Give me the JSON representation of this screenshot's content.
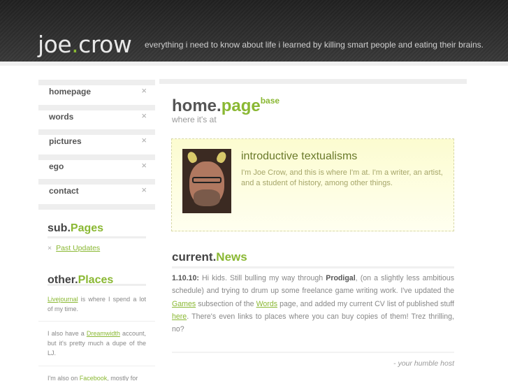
{
  "header": {
    "logo_part1": "joe",
    "logo_dot": ".",
    "logo_part2": "crow",
    "tagline": "everything i need to know about life i learned by killing smart people and eating their brains."
  },
  "nav": {
    "items": [
      {
        "label": "homepage"
      },
      {
        "label": "words"
      },
      {
        "label": "pictures"
      },
      {
        "label": "ego"
      },
      {
        "label": "contact"
      }
    ],
    "close_glyph": "×"
  },
  "sidebar": {
    "sub_pages": {
      "prefix": "sub.",
      "highlight": "Pages",
      "items": [
        {
          "label": "Past Updates"
        }
      ]
    },
    "other_places": {
      "prefix": "other.",
      "highlight": "Places",
      "p1_link": "Livejournal",
      "p1_text": " is where I spend a lot of my time.",
      "p2_text1": "I also have a ",
      "p2_link": "Dreamwidth",
      "p2_text2": " account, but it's pretty much a dupe of the LJ.",
      "p3_text1": "I'm also on ",
      "p3_link": "Facebook",
      "p3_text2": ", mostly for"
    }
  },
  "main": {
    "title_prefix": "home.",
    "title_highlight": "page",
    "title_sup": "base",
    "subtitle": "where it's at",
    "intro": {
      "heading": "introductive textualisms",
      "body": "I'm Joe Crow, and this is where I'm at. I'm a writer, an artist, and a student of history, among other things."
    },
    "news": {
      "prefix": "current.",
      "highlight": "News",
      "date": "1.10.10:",
      "t1": " Hi kids. Still bulling my way through ",
      "bold1": "Prodigal",
      "t2": ", (on a slightly less ambitious schedule) and trying to drum up some freelance game writing work. I've updated the ",
      "link1": "Games",
      "t3": " subsection of the ",
      "link2": "Words",
      "t4": " page, and added my current CV list of published stuff ",
      "link3": "here",
      "t5": ". There's even links to places where you can buy copies of them! Trez thrilling, no?",
      "signature": "- your humble host"
    }
  }
}
